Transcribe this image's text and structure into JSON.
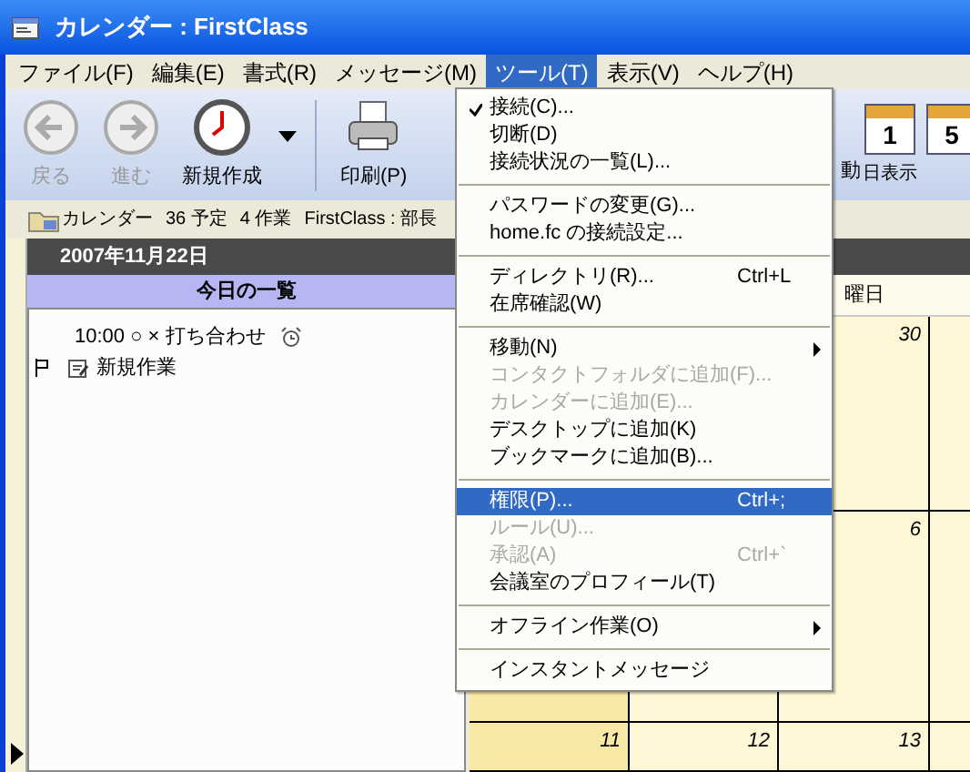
{
  "window": {
    "title": "カレンダー : FirstClass"
  },
  "menu_bar": [
    {
      "label": "ファイル(F)",
      "selected": false
    },
    {
      "label": "編集(E)",
      "selected": false
    },
    {
      "label": "書式(R)",
      "selected": false
    },
    {
      "label": "メッセージ(M)",
      "selected": false
    },
    {
      "label": "ツール(T)",
      "selected": true
    },
    {
      "label": "表示(V)",
      "selected": false
    },
    {
      "label": "ヘルプ(H)",
      "selected": false
    }
  ],
  "toolbar_left": [
    {
      "kind": "back",
      "label": "戻る",
      "disabled": true
    },
    {
      "kind": "forward",
      "label": "進む",
      "disabled": true
    },
    {
      "kind": "new",
      "label": "新規作成",
      "disabled": false
    },
    {
      "kind": "dropdown"
    },
    {
      "kind": "separator"
    },
    {
      "kind": "print",
      "label": "印刷(P)",
      "disabled": false
    }
  ],
  "toolbar_right": [
    {
      "kind": "text",
      "label": "動"
    },
    {
      "kind": "calendar",
      "label": "日表示",
      "icon_text": "1"
    },
    {
      "kind": "calendar",
      "icon_text": "5"
    }
  ],
  "info_bar": {
    "folder": "カレンダー",
    "events": "36 予定",
    "tasks": "4 作業",
    "path": "FirstClass : 部長"
  },
  "date": "2007年11月22日",
  "list_header": "今日の一覧",
  "list_items": [
    {
      "kind": "event",
      "text": "10:00 ○ × 打ち合わせ"
    },
    {
      "kind": "task",
      "text": "新規作業"
    }
  ],
  "calendar": {
    "day_header": "曜日",
    "columns": [
      {
        "weekend": true
      },
      {
        "weekend": false
      },
      {
        "weekend": false
      },
      {
        "weekend": false
      }
    ],
    "weeks": [
      {
        "days": [
          {
            "kind": "date",
            "label": "30"
          },
          {
            "kind": "blank"
          }
        ]
      },
      {
        "days": [
          {
            "kind": "blank"
          },
          {
            "kind": "blank"
          },
          {
            "kind": "date",
            "label": "6"
          },
          {
            "kind": "blank"
          }
        ]
      },
      {
        "days": [
          {
            "kind": "date",
            "label": "11"
          },
          {
            "kind": "date",
            "label": "12"
          },
          {
            "kind": "date",
            "label": "13"
          },
          {
            "kind": "blank"
          }
        ]
      }
    ]
  },
  "tools_menu": [
    {
      "kind": "item",
      "label": "接続(C)...",
      "checked": true,
      "disabled": false,
      "selected": false
    },
    {
      "kind": "item",
      "label": "切断(D)",
      "disabled": false,
      "selected": false
    },
    {
      "kind": "item",
      "label": "接続状況の一覧(L)...",
      "disabled": false,
      "selected": false
    },
    {
      "kind": "separator"
    },
    {
      "kind": "item",
      "label": "パスワードの変更(G)...",
      "disabled": false,
      "selected": false
    },
    {
      "kind": "item",
      "label": "home.fc の接続設定...",
      "disabled": false,
      "selected": false
    },
    {
      "kind": "separator"
    },
    {
      "kind": "item",
      "label": "ディレクトリ(R)...",
      "shortcut": "Ctrl+L",
      "disabled": false,
      "selected": false
    },
    {
      "kind": "item",
      "label": "在席確認(W)",
      "disabled": false,
      "selected": false
    },
    {
      "kind": "separator"
    },
    {
      "kind": "item",
      "label": "移動(N)",
      "submenu": true,
      "disabled": false,
      "selected": false
    },
    {
      "kind": "item",
      "label": "コンタクトフォルダに追加(F)...",
      "disabled": true,
      "selected": false
    },
    {
      "kind": "item",
      "label": "カレンダーに追加(E)...",
      "disabled": true,
      "selected": false
    },
    {
      "kind": "item",
      "label": "デスクトップに追加(K)",
      "disabled": false,
      "selected": false
    },
    {
      "kind": "item",
      "label": "ブックマークに追加(B)...",
      "disabled": false,
      "selected": false
    },
    {
      "kind": "separator"
    },
    {
      "kind": "item",
      "label": "権限(P)...",
      "shortcut": "Ctrl+;",
      "disabled": false,
      "selected": true
    },
    {
      "kind": "item",
      "label": "ルール(U)...",
      "disabled": true,
      "selected": false
    },
    {
      "kind": "item",
      "label": "承認(A)",
      "shortcut": "Ctrl+`",
      "disabled": true,
      "selected": false
    },
    {
      "kind": "item",
      "label": "会議室のプロフィール(T)",
      "disabled": false,
      "selected": false
    },
    {
      "kind": "separator"
    },
    {
      "kind": "item",
      "label": "オフライン作業(O)",
      "submenu": true,
      "disabled": false,
      "selected": false
    },
    {
      "kind": "separator"
    },
    {
      "kind": "item",
      "label": "インスタントメッセージ",
      "disabled": false,
      "selected": false
    }
  ]
}
